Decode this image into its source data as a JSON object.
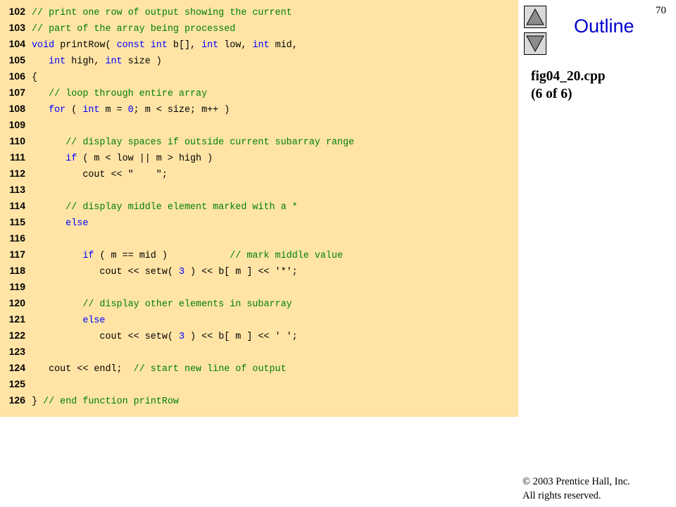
{
  "slide": {
    "page_number": "70",
    "outline_label": "Outline",
    "file_name": "fig04_20.cpp",
    "part": "(6 of 6)",
    "copyright_line1": "© 2003 Prentice Hall, Inc.",
    "copyright_line2": "All rights reserved."
  },
  "navigation": {
    "up_icon": "triangle-up-icon",
    "down_icon": "triangle-down-icon"
  },
  "colors": {
    "code_background": "#ffe4a6",
    "comment": "#008000",
    "keyword": "#0000ff",
    "outline_title": "#0000cc"
  },
  "code": {
    "lines": [
      {
        "num": "102",
        "tokens": [
          {
            "t": "cmt",
            "v": "// print one row of output showing the current"
          }
        ]
      },
      {
        "num": "103",
        "tokens": [
          {
            "t": "cmt",
            "v": "// part of the array being processed"
          }
        ]
      },
      {
        "num": "104",
        "tokens": [
          {
            "t": "kw",
            "v": "void"
          },
          {
            "t": "txt",
            "v": " printRow( "
          },
          {
            "t": "kw",
            "v": "const int"
          },
          {
            "t": "txt",
            "v": " b[], "
          },
          {
            "t": "kw",
            "v": "int"
          },
          {
            "t": "txt",
            "v": " low, "
          },
          {
            "t": "kw",
            "v": "int"
          },
          {
            "t": "txt",
            "v": " mid,"
          }
        ]
      },
      {
        "num": "105",
        "tokens": [
          {
            "t": "txt",
            "v": "   "
          },
          {
            "t": "kw",
            "v": "int"
          },
          {
            "t": "txt",
            "v": " high, "
          },
          {
            "t": "kw",
            "v": "int"
          },
          {
            "t": "txt",
            "v": " size )"
          }
        ]
      },
      {
        "num": "106",
        "tokens": [
          {
            "t": "txt",
            "v": "{"
          }
        ]
      },
      {
        "num": "107",
        "tokens": [
          {
            "t": "txt",
            "v": "   "
          },
          {
            "t": "cmt",
            "v": "// loop through entire array"
          }
        ]
      },
      {
        "num": "108",
        "tokens": [
          {
            "t": "txt",
            "v": "   "
          },
          {
            "t": "kw",
            "v": "for"
          },
          {
            "t": "txt",
            "v": " ( "
          },
          {
            "t": "kw",
            "v": "int"
          },
          {
            "t": "txt",
            "v": " m = "
          },
          {
            "t": "num",
            "v": "0"
          },
          {
            "t": "txt",
            "v": "; m < size; m++ )"
          }
        ]
      },
      {
        "num": "109",
        "tokens": []
      },
      {
        "num": "110",
        "tokens": [
          {
            "t": "txt",
            "v": "      "
          },
          {
            "t": "cmt",
            "v": "// display spaces if outside current subarray range"
          }
        ]
      },
      {
        "num": "111",
        "tokens": [
          {
            "t": "txt",
            "v": "      "
          },
          {
            "t": "kw",
            "v": "if"
          },
          {
            "t": "txt",
            "v": " ( m < low || m > high )"
          }
        ]
      },
      {
        "num": "112",
        "tokens": [
          {
            "t": "txt",
            "v": "         cout << \"    \";"
          }
        ]
      },
      {
        "num": "113",
        "tokens": []
      },
      {
        "num": "114",
        "tokens": [
          {
            "t": "txt",
            "v": "      "
          },
          {
            "t": "cmt",
            "v": "// display middle element marked with a *"
          }
        ]
      },
      {
        "num": "115",
        "tokens": [
          {
            "t": "txt",
            "v": "      "
          },
          {
            "t": "kw",
            "v": "else"
          }
        ]
      },
      {
        "num": "116",
        "tokens": []
      },
      {
        "num": "117",
        "tokens": [
          {
            "t": "txt",
            "v": "         "
          },
          {
            "t": "kw",
            "v": "if"
          },
          {
            "t": "txt",
            "v": " ( m == mid )           "
          },
          {
            "t": "cmt",
            "v": "// mark middle value"
          }
        ]
      },
      {
        "num": "118",
        "tokens": [
          {
            "t": "txt",
            "v": "            cout << setw( "
          },
          {
            "t": "num",
            "v": "3"
          },
          {
            "t": "txt",
            "v": " ) << b[ m ] << '*';"
          }
        ]
      },
      {
        "num": "119",
        "tokens": []
      },
      {
        "num": "120",
        "tokens": [
          {
            "t": "txt",
            "v": "         "
          },
          {
            "t": "cmt",
            "v": "// display other elements in subarray"
          }
        ]
      },
      {
        "num": "121",
        "tokens": [
          {
            "t": "txt",
            "v": "         "
          },
          {
            "t": "kw",
            "v": "else"
          }
        ]
      },
      {
        "num": "122",
        "tokens": [
          {
            "t": "txt",
            "v": "            cout << setw( "
          },
          {
            "t": "num",
            "v": "3"
          },
          {
            "t": "txt",
            "v": " ) << b[ m ] << ' ';"
          }
        ]
      },
      {
        "num": "123",
        "tokens": []
      },
      {
        "num": "124",
        "tokens": [
          {
            "t": "txt",
            "v": "   cout << endl;  "
          },
          {
            "t": "cmt",
            "v": "// start new line of output"
          }
        ]
      },
      {
        "num": "125",
        "tokens": []
      },
      {
        "num": "126",
        "tokens": [
          {
            "t": "txt",
            "v": "} "
          },
          {
            "t": "cmt",
            "v": "// end function printRow"
          }
        ]
      }
    ]
  }
}
